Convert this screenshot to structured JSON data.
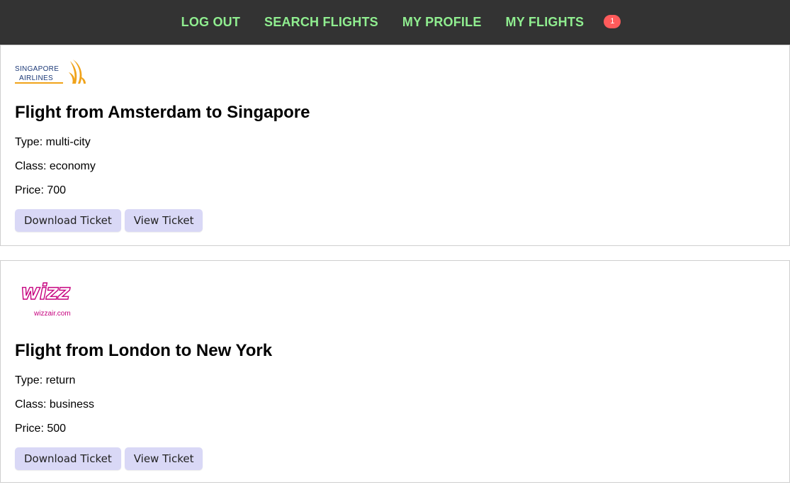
{
  "nav": {
    "links": [
      {
        "label": "LOG OUT"
      },
      {
        "label": "SEARCH FLIGHTS"
      },
      {
        "label": "MY PROFILE"
      },
      {
        "label": "MY FLIGHTS"
      }
    ],
    "badge_count": "1"
  },
  "colors": {
    "navbar_bg": "#333333",
    "nav_link": "#90ee90",
    "badge_bg": "#ff5b5b",
    "button_bg": "#d9d8f6"
  },
  "flights": [
    {
      "logo": {
        "name": "singapore-airlines-logo",
        "line1": "SINGAPORE",
        "line2": "AIRLINES"
      },
      "title": "Flight from Amsterdam to Singapore",
      "type": "Type: multi-city",
      "class": "Class: economy",
      "price": "Price: 700",
      "download_label": "Download Ticket",
      "view_label": "View Ticket"
    },
    {
      "logo": {
        "name": "wizzair-logo",
        "line1": "wizz",
        "line2": "wizzair.com"
      },
      "title": "Flight from London to New York",
      "type": "Type: return",
      "class": "Class: business",
      "price": "Price: 500",
      "download_label": "Download Ticket",
      "view_label": "View Ticket"
    }
  ]
}
